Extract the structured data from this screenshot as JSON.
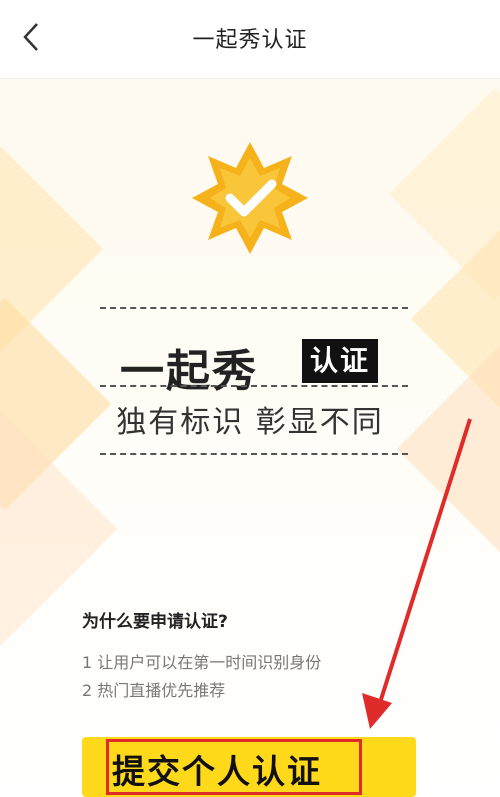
{
  "header": {
    "title": "一起秀认证",
    "back_icon": "chevron-left-icon"
  },
  "hero": {
    "badge_icon": "verified-check-badge-icon",
    "brand": "一起秀",
    "tag": "认证",
    "slogan": "独有标识  彰显不同"
  },
  "info": {
    "question": "为什么要申请认证?",
    "reasons": [
      "1 让用户可以在第一时间识别身份",
      "2 热门直播优先推荐"
    ]
  },
  "cta": {
    "label": "提交个人认证"
  },
  "colors": {
    "accent": "#ffd91a",
    "badge": "#f6b21a",
    "highlight": "#e02b2b"
  }
}
